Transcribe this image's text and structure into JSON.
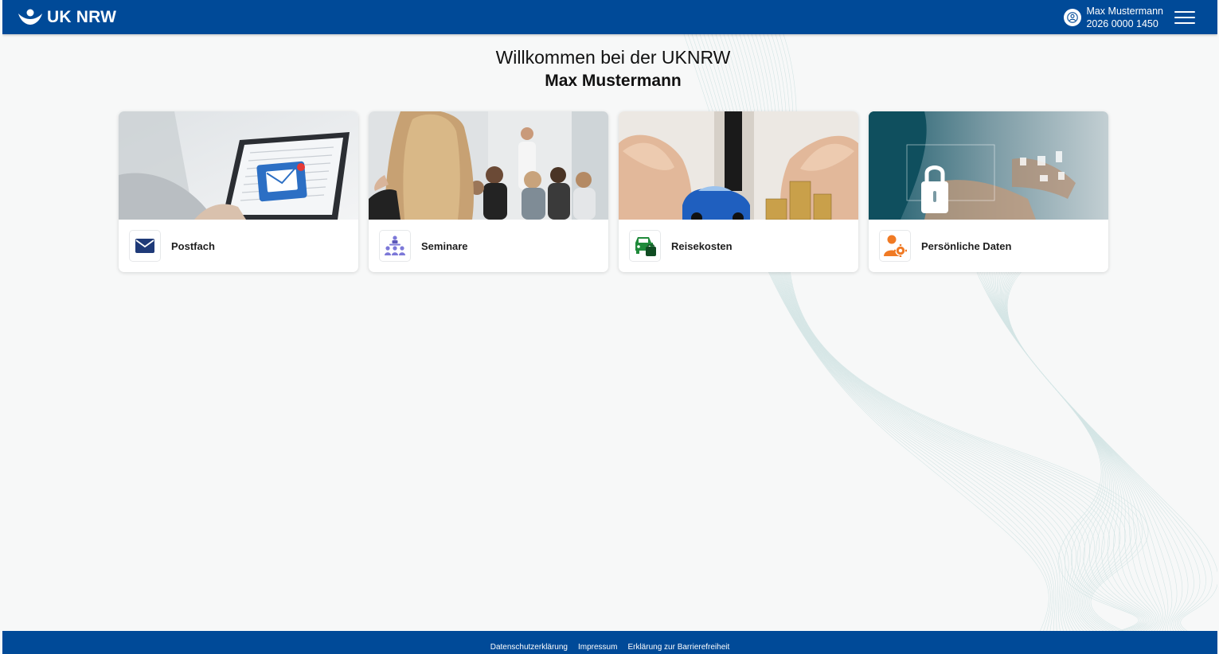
{
  "header": {
    "logo_text": "UK NRW",
    "user_name": "Max Mustermann",
    "user_number": "2026 0000 1450",
    "background_color": "#004a98"
  },
  "welcome": {
    "line1": "Willkommen bei der UKNRW",
    "line2": "Max Mustermann"
  },
  "tiles": [
    {
      "label": "Postfach",
      "icon": "envelope-icon",
      "image": "laptop-email-photo"
    },
    {
      "label": "Seminare",
      "icon": "seminar-group-icon",
      "image": "seminar-audience-photo"
    },
    {
      "label": "Reisekosten",
      "icon": "car-wallet-icon",
      "image": "car-coins-photo"
    },
    {
      "label": "Persönliche Daten",
      "icon": "user-settings-icon",
      "image": "padlock-data-photo"
    }
  ],
  "footer": {
    "links": [
      "Datenschutzerklärung",
      "Impressum",
      "Erklärung zur Barrierefreiheit"
    ]
  },
  "colors": {
    "primary": "#004a98",
    "background": "#f7f8f8",
    "postfach_icon": "#1f3a78",
    "seminare_icon": "#7c78d8",
    "reisekosten_icon": "#1f8a3a",
    "persoenliche_icon": "#f07a24"
  }
}
